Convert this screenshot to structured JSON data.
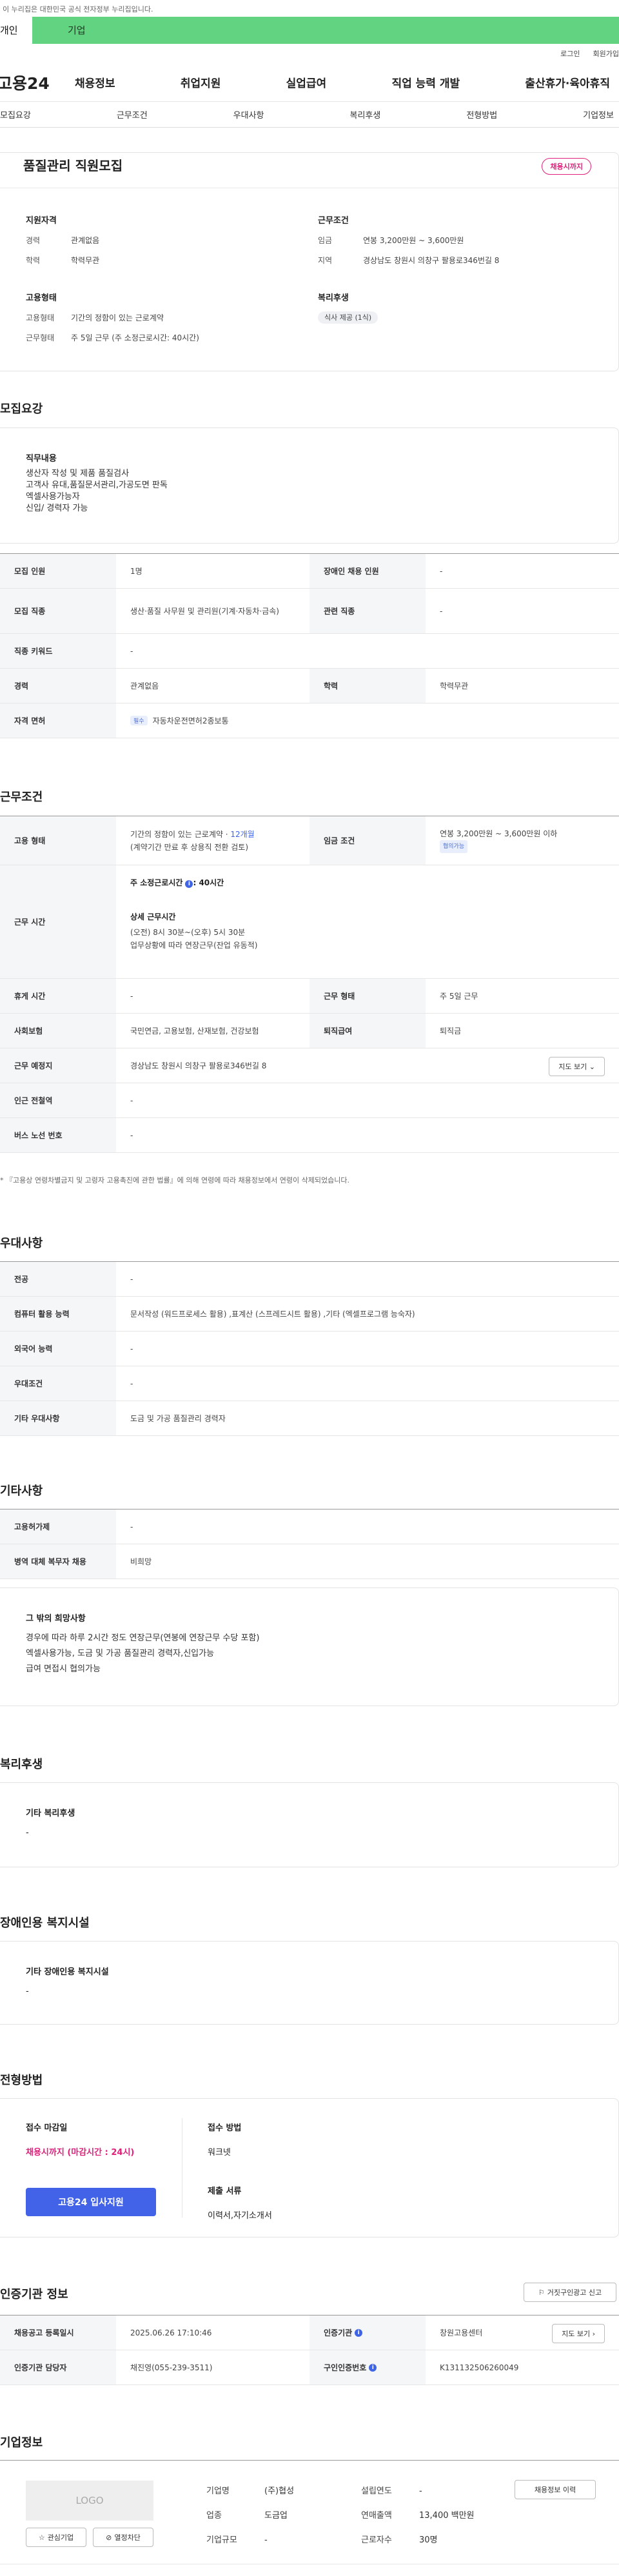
{
  "gov_banner": "이 누리집은 대한민국 공식 전자정부 누리집입니다.",
  "tabbar": {
    "left": "개인",
    "right": "기업"
  },
  "util": {
    "login": "로그인",
    "join": "회원가입"
  },
  "logo": "고용24",
  "gnb": [
    "채용정보",
    "취업지원",
    "실업급여",
    "직업 능력 개발",
    "출산휴가·육아휴직"
  ],
  "tabs": [
    "모집요강",
    "근무조건",
    "우대사항",
    "복리후생",
    "전형방법",
    "기업정보"
  ],
  "summary": {
    "title": "품질관리 직원모집",
    "badge": "채용시까지",
    "qual": {
      "title": "지원자격",
      "career_k": "경력",
      "career_v": "관계없음",
      "edu_k": "학력",
      "edu_v": "학력무관"
    },
    "cond": {
      "title": "근무조건",
      "wage_k": "임금",
      "wage_v": "연봉 3,200만원 ~ 3,600만원",
      "region_k": "지역",
      "region_v": "경상남도 창원시 의창구 팔용로346번길 8"
    },
    "emp": {
      "title": "고용형태",
      "type_k": "고용형태",
      "type_v": "기간의 정함이 있는 근로계약",
      "work_k": "근무형태",
      "work_v": "주 5일 근무 (주 소정근로시간: 40시간)"
    },
    "welfare": {
      "title": "복리후생",
      "pill": "식사 제공 (1식)"
    }
  },
  "recruit": {
    "title": "모집요강",
    "duty_title": "직무내용",
    "duty_lines": [
      "생산자 작성 및 제품 품질검사",
      "고객사 유대,품질문서관리,가공도면 판독",
      "엑셀사용가능자",
      "신입/ 경력자 가능"
    ],
    "rows": {
      "count_k": "모집 인원",
      "count_v": "1명",
      "disabled_k": "장애인 채용 인원",
      "disabled_v": "-",
      "job_k": "모집 직종",
      "job_v": "생산·품질 사무원 및 관리원(기계·자동차·금속)",
      "related_k": "관련 직종",
      "related_v": "-",
      "kw_k": "직종 키워드",
      "kw_v": "-",
      "career_k": "경력",
      "career_v": "관계없음",
      "edu_k": "학력",
      "edu_v": "학력무관",
      "license_k": "자격 면허",
      "license_tag": "필수",
      "license_v": "자동차운전면허2종보통"
    }
  },
  "work": {
    "title": "근무조건",
    "emp_k": "고용 형태",
    "emp_v1": "기간의 정함이 있는 근로계약 · ",
    "emp_v1_blue": "12개월",
    "emp_v2": "(계약기간 만료 후 상용직 전환 검토)",
    "wage_k": "임금 조건",
    "wage_v": "연봉 3,200만원 ~ 3,600만원 이하",
    "wage_tag": "협의가능",
    "hours_k": "근무 시간",
    "hours_main": "주 소정근로시간",
    "hours_main_v": ": 40시간",
    "hours_detail_title": "상세 근무시간",
    "hours_detail_1": "(오전) 8시 30분~(오후) 5시 30분",
    "hours_detail_2": "업무상황에 따라 연장근무(잔업 유동적)",
    "rest_k": "휴게 시간",
    "rest_v": "-",
    "worktype_k": "근무 형태",
    "worktype_v": "주 5일 근무",
    "insurance_k": "사회보험",
    "insurance_v": "국민연금, 고용보험, 산재보험, 건강보험",
    "retire_k": "퇴직급여",
    "retire_v": "퇴직금",
    "place_k": "근무 예정지",
    "place_v": "경상남도 창원시 의창구 팔용로346번길 8",
    "map_btn": "지도 보기",
    "subway_k": "인근 전철역",
    "subway_v": "-",
    "bus_k": "버스 노선 번호",
    "bus_v": "-",
    "note": "* 『고용상 연령차별금지 및 고령자 고용촉진에 관한 법률』에 의해 연령에 따라 채용정보에서 연령이 삭제되었습니다."
  },
  "pref": {
    "title": "우대사항",
    "major_k": "전공",
    "major_v": "-",
    "pc_k": "컴퓨터 활용 능력",
    "pc_v": "문서작성 (워드프로세스 활용) ,표계산 (스프레드시트 활용) ,기타 (엑셀프로그램 능숙자)",
    "lang_k": "외국어 능력",
    "lang_v": "-",
    "cond_k": "우대조건",
    "cond_v": "-",
    "etc_k": "기타 우대사항",
    "etc_v": "도금 및 가공 품질관리 경력자"
  },
  "etc": {
    "title": "기타사항",
    "emp_sub_k": "고용허가제",
    "emp_sub_v": "-",
    "mil_k": "병역 대체 복무자 채용",
    "mil_v": "비희망",
    "box_title": "그 밖의 희망사항",
    "box_lines": [
      "경우에 따라 하루 2시간 정도 연장근무(연봉에 연장근무 수당 포함)",
      "엑셀사용가능, 도금 및 가공 품질관리 경력자,신입가능",
      "급여 면접시 협의가능"
    ]
  },
  "welfare": {
    "title": "복리후생",
    "box_title": "기타 복리후생",
    "box_v": "-"
  },
  "facility": {
    "title": "장애인용 복지시설",
    "box_title": "기타 장애인용 복지시설",
    "box_v": "-"
  },
  "process": {
    "title": "전형방법",
    "deadline_k": "접수 마감일",
    "deadline_v": "채용시까지 (마감시간 : 24시)",
    "method_k": "접수 방법",
    "method_v": "워크넷",
    "docs_k": "제출 서류",
    "docs_v": "이력서,자기소개서",
    "apply_btn": "고용24 입사지원"
  },
  "agency": {
    "title": "인증기관 정보",
    "report_btn": "거짓구인광고 신고",
    "reg_k": "채용공고 등록일시",
    "reg_v": "2025.06.26 17:10:46",
    "org_k": "인증기관",
    "org_v": "창원고용센터",
    "map_btn": "지도 보기",
    "mgr_k": "인증기관 담당자",
    "mgr_v": "채진영(055-239-3511)",
    "no_k": "구인인증번호",
    "no_v": "K131132506260049"
  },
  "company": {
    "title": "기업정보",
    "logo": "LOGO",
    "fav_btn": "관심기업",
    "follow_btn": "열정차단",
    "history_btn": "채용정보 이력",
    "name_k": "기업명",
    "name_v": "(주)협성",
    "year_k": "설립연도",
    "year_v": "-",
    "ind_k": "업종",
    "ind_v": "도금업",
    "sales_k": "연매출액",
    "sales_v": "13,400 백만원",
    "size_k": "기업규모",
    "size_v": "-",
    "staff_k": "근로자수",
    "staff_v": "30명"
  }
}
